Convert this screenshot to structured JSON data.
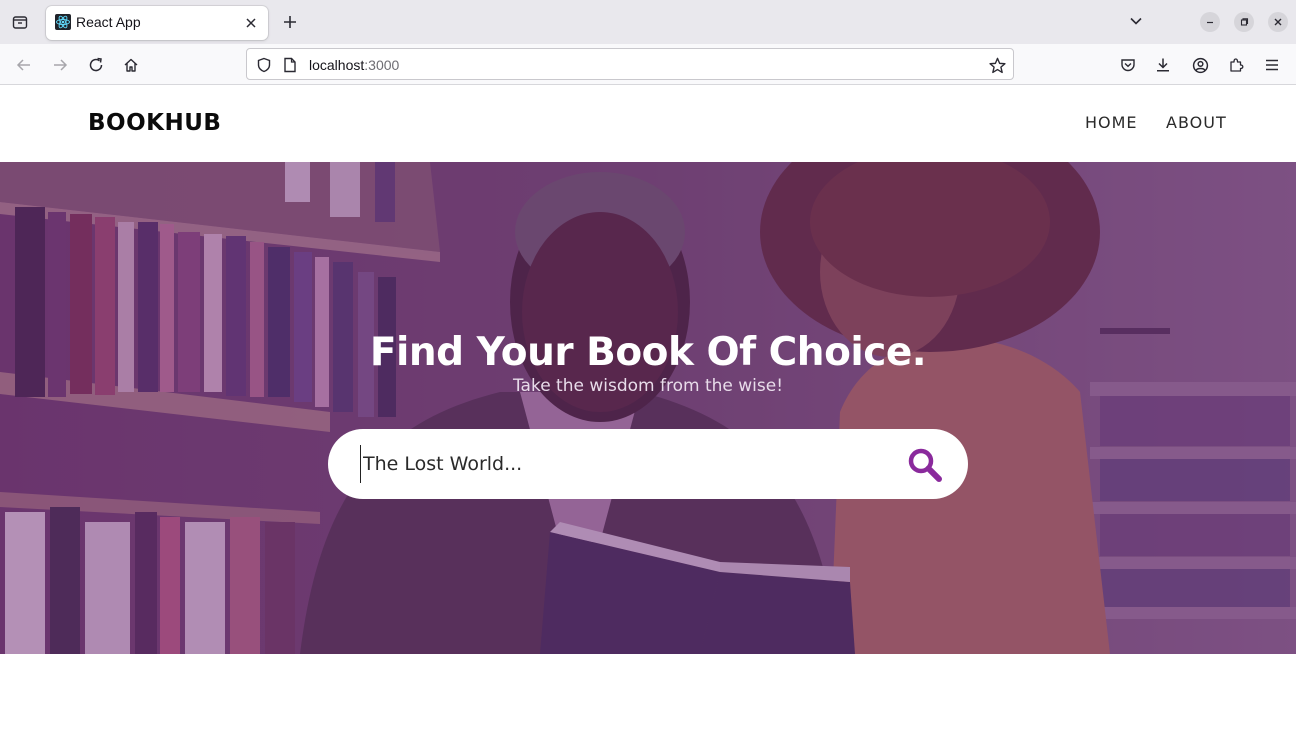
{
  "browser": {
    "tab": {
      "title": "React App"
    },
    "address": {
      "host": "localhost",
      "port": ":3000"
    },
    "icons": {
      "tab_list": "tab-list-icon",
      "favicon": "react-icon",
      "tab_close": "close-icon",
      "new_tab": "plus-icon",
      "tab_overflow": "chevron-down-icon",
      "minimize": "minimize-icon",
      "restore": "restore-icon",
      "close_window": "close-icon",
      "back": "back-arrow-icon",
      "forward": "forward-arrow-icon",
      "reload": "reload-icon",
      "home": "home-icon",
      "shield": "shield-icon",
      "page": "page-icon",
      "bookmark": "star-icon",
      "pocket": "pocket-icon",
      "downloads": "download-icon",
      "account": "account-icon",
      "extensions": "puzzle-icon",
      "menu": "hamburger-icon"
    }
  },
  "site": {
    "logo": "BOOKHUB",
    "nav": [
      {
        "label": "HOME"
      },
      {
        "label": "ABOUT"
      }
    ]
  },
  "hero": {
    "title": "Find Your Book Of Choice.",
    "subtitle": "Take the wisdom from the wise!",
    "search": {
      "placeholder": "The Lost World...",
      "value": ""
    },
    "search_icon": "search-icon"
  },
  "colors": {
    "accent": "#8a2a9c",
    "overlay": "#6b2d78",
    "chrome_bg": "#e9e8ed",
    "toolbar_bg": "#f9f9fb"
  }
}
